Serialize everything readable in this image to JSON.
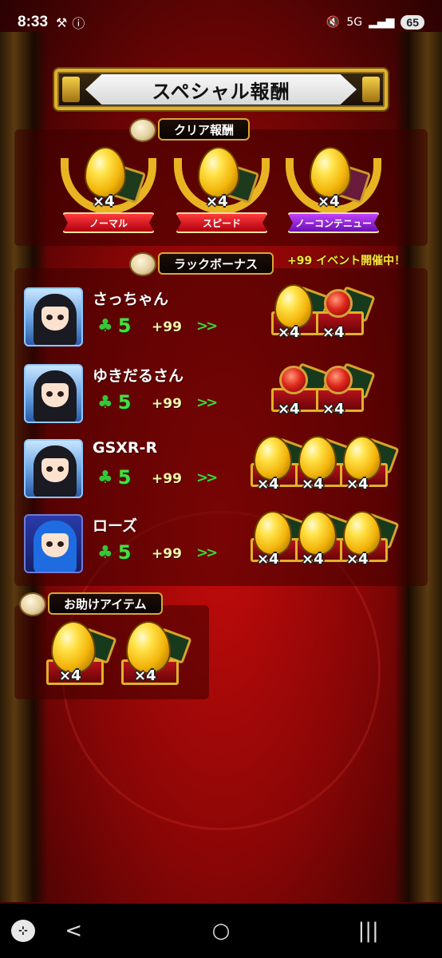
{
  "status_bar": {
    "time": "8:33",
    "network": "5G",
    "battery": "65"
  },
  "title": "スペシャル報酬",
  "clear_rewards": {
    "label": "クリア報酬",
    "items": [
      {
        "qty": "×4",
        "ribbon": "ノーマル",
        "ribbon_color": "#d01020"
      },
      {
        "qty": "×4",
        "ribbon": "スピード",
        "ribbon_color": "#d01020"
      },
      {
        "qty": "×4",
        "ribbon": "ノーコンテニュー",
        "ribbon_color": "#8a20d0"
      }
    ]
  },
  "luck_bonus": {
    "label": "ラックボーナス",
    "event_text": "+99 イベント開催中！",
    "players": [
      {
        "name": "さっちゃん",
        "luck": "5",
        "bonus": "+99",
        "arrows": ">>",
        "rewards": [
          {
            "kind": "egg",
            "qty": "×4"
          },
          {
            "kind": "orb",
            "qty": "×4"
          }
        ]
      },
      {
        "name": "ゆきだるさん",
        "luck": "5",
        "bonus": "+99",
        "arrows": ">>",
        "rewards": [
          {
            "kind": "orb",
            "qty": "×4"
          },
          {
            "kind": "orb",
            "qty": "×4"
          }
        ]
      },
      {
        "name": "GSXR-R",
        "luck": "5",
        "bonus": "+99",
        "arrows": ">>",
        "rewards": [
          {
            "kind": "egg",
            "qty": "×4"
          },
          {
            "kind": "egg",
            "qty": "×4"
          },
          {
            "kind": "egg",
            "qty": "×4"
          }
        ]
      },
      {
        "name": "ローズ",
        "luck": "5",
        "bonus": "+99",
        "arrows": ">>",
        "rewards": [
          {
            "kind": "egg",
            "qty": "×4"
          },
          {
            "kind": "egg",
            "qty": "×4"
          },
          {
            "kind": "egg",
            "qty": "×4"
          }
        ]
      }
    ]
  },
  "helper_items": {
    "label": "お助けアイテム",
    "items": [
      {
        "kind": "egg",
        "qty": "×4"
      },
      {
        "kind": "egg",
        "qty": "×4"
      }
    ]
  },
  "nav": {
    "back": "<",
    "home": "○",
    "recents": "|||"
  },
  "colors": {
    "accent_gold": "#e0b12a",
    "luck_green": "#44e040",
    "event_yellow": "#ffe23c"
  }
}
